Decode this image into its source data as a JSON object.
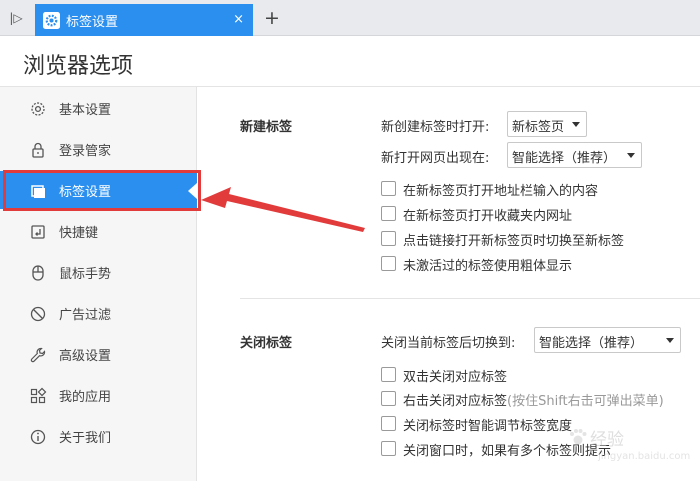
{
  "colors": {
    "accent": "#2b8ff0",
    "annotation": "#e23b3b"
  },
  "tab": {
    "title": "标签设置",
    "icon": "gear-icon",
    "close": "×"
  },
  "new_tab": "+",
  "sidebar_toggle": "|▷",
  "page_title": "浏览器选项",
  "sidebar": {
    "items": [
      {
        "label": "基本设置",
        "icon": "gear-icon"
      },
      {
        "label": "登录管家",
        "icon": "lock-icon"
      },
      {
        "label": "标签设置",
        "icon": "tab-icon",
        "active": true
      },
      {
        "label": "快捷键",
        "icon": "shortcut-icon"
      },
      {
        "label": "鼠标手势",
        "icon": "mouse-icon"
      },
      {
        "label": "广告过滤",
        "icon": "block-icon"
      },
      {
        "label": "高级设置",
        "icon": "wrench-icon"
      },
      {
        "label": "我的应用",
        "icon": "apps-icon"
      },
      {
        "label": "关于我们",
        "icon": "info-icon"
      }
    ]
  },
  "new_tab_section": {
    "title": "新建标签",
    "open_label": "新创建标签时打开:",
    "open_value": "新标签页",
    "position_label": "新打开网页出现在:",
    "position_value": "智能选择（推荐）",
    "options": [
      {
        "label": "在新标签页打开地址栏输入的内容",
        "checked": false
      },
      {
        "label": "在新标签页打开收藏夹内网址",
        "checked": false
      },
      {
        "label": "点击链接打开新标签页时切换至新标签",
        "checked": false
      },
      {
        "label": "未激活过的标签使用粗体显示",
        "checked": false
      }
    ]
  },
  "close_tab_section": {
    "title": "关闭标签",
    "switch_label": "关闭当前标签后切换到:",
    "switch_value": "智能选择（推荐）",
    "options": [
      {
        "label": "双击关闭对应标签",
        "hint": "",
        "checked": false
      },
      {
        "label": "右击关闭对应标签",
        "hint": "(按住Shift右击可弹出菜单)",
        "checked": false
      },
      {
        "label": "关闭标签时智能调节标签宽度",
        "hint": "",
        "checked": false
      },
      {
        "label": "关闭窗口时，如果有多个标签则提示",
        "hint": "",
        "checked": false
      }
    ]
  },
  "watermark": {
    "text": "经验",
    "url": "jingyan.baidu.com"
  }
}
